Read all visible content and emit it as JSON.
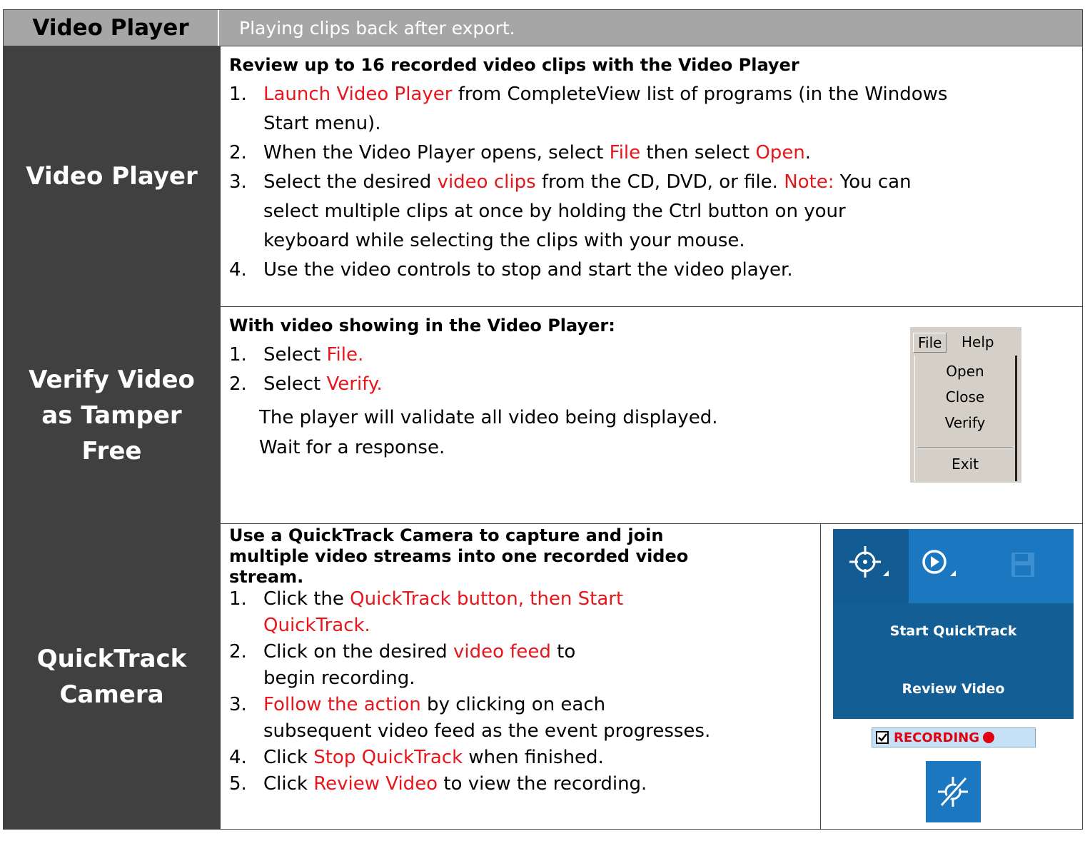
{
  "header": {
    "left": "Video Player",
    "right": "Playing clips back after export."
  },
  "rows": [
    {
      "label": "Video Player",
      "title": "Review up to 16 recorded video clips with the Video Player",
      "steps": [
        {
          "num": "1.",
          "lines": [
            [
              {
                "t": "Launch Video Player",
                "red": true
              },
              {
                "t": " from CompleteView list of programs (in the Windows"
              }
            ],
            [
              {
                "t": "Start  menu)."
              }
            ]
          ]
        },
        {
          "num": "2.",
          "lines": [
            [
              {
                "t": "When the Video Player opens, select "
              },
              {
                "t": "File",
                "red": true
              },
              {
                "t": " then select "
              },
              {
                "t": "Open",
                "red": true
              },
              {
                "t": "."
              }
            ]
          ]
        },
        {
          "num": "3.",
          "lines": [
            [
              {
                "t": "Select the desired "
              },
              {
                "t": "video clips",
                "red": true
              },
              {
                "t": " from the CD, DVD, or file. "
              },
              {
                "t": "Note:",
                "red": true
              },
              {
                "t": " You can"
              }
            ],
            [
              {
                "t": "select  multiple clips at once by holding the Ctrl button on your"
              }
            ],
            [
              {
                "t": "keyboard while  selecting the clips with your mouse."
              }
            ]
          ]
        },
        {
          "num": "4.",
          "lines": [
            [
              {
                "t": "Use the video controls to stop and start the video player."
              }
            ]
          ]
        }
      ]
    },
    {
      "label": "Verify Video as Tamper Free",
      "label_lines": [
        "Verify Video",
        "as Tamper",
        "Free"
      ],
      "title": "With video showing in the Video Player:",
      "steps": [
        {
          "num": "1.",
          "lines": [
            [
              {
                "t": "Select "
              },
              {
                "t": "File.",
                "red": true
              }
            ]
          ]
        },
        {
          "num": "2.",
          "lines": [
            [
              {
                "t": "Select "
              },
              {
                "t": "Verify.",
                "red": true
              }
            ]
          ]
        }
      ],
      "notes": [
        "The player will validate all video being displayed.",
        "Wait for a  response."
      ],
      "menu": {
        "bar": [
          "File",
          "Help"
        ],
        "items": [
          "Open",
          "Close",
          "Verify",
          "Exit"
        ]
      }
    },
    {
      "label": "QuickTrack Camera",
      "label_lines": [
        "QuickTrack",
        "Camera"
      ],
      "title_lines": [
        "Use a QuickTrack Camera to capture and join",
        "multiple video streams into one recorded video",
        "stream."
      ],
      "steps": [
        {
          "num": "1.",
          "lines": [
            [
              {
                "t": "Click the "
              },
              {
                "t": "QuickTrack button, then Start",
                "red": true
              }
            ],
            [
              {
                "t": "QuickTrack.",
                "red": true
              }
            ]
          ]
        },
        {
          "num": "2.",
          "lines": [
            [
              {
                "t": "Click on the desired "
              },
              {
                "t": "video feed",
                "red": true
              },
              {
                "t": " to"
              }
            ],
            [
              {
                "t": "begin recording."
              }
            ]
          ]
        },
        {
          "num": "3.",
          "lines": [
            [
              {
                "t": "Follow the action",
                "red": true
              },
              {
                "t": " by clicking on each"
              }
            ],
            [
              {
                "t": "subsequent video feed as the event progresses."
              }
            ]
          ]
        },
        {
          "num": "4.",
          "lines": [
            [
              {
                "t": "Click "
              },
              {
                "t": "Stop QuickTrack",
                "red": true
              },
              {
                "t": " when finished."
              }
            ]
          ]
        },
        {
          "num": "5.",
          "lines": [
            [
              {
                "t": "Click "
              },
              {
                "t": "Review Video",
                "red": true
              },
              {
                "t": " to view the recording."
              }
            ]
          ]
        }
      ],
      "toolbar": {
        "menu_items": [
          "Start QuickTrack",
          "Review Video"
        ],
        "recording_label": "RECORDING",
        "icons": [
          "quicktrack-icon",
          "play-icon",
          "save-icon",
          "stop-quicktrack-icon"
        ]
      }
    }
  ],
  "colors": {
    "red": "#e8151b",
    "header_bg": "#a6a6a6",
    "label_bg": "#404040",
    "toolbar_blue": "#1b78c0",
    "toolbar_dark": "#145e96"
  }
}
